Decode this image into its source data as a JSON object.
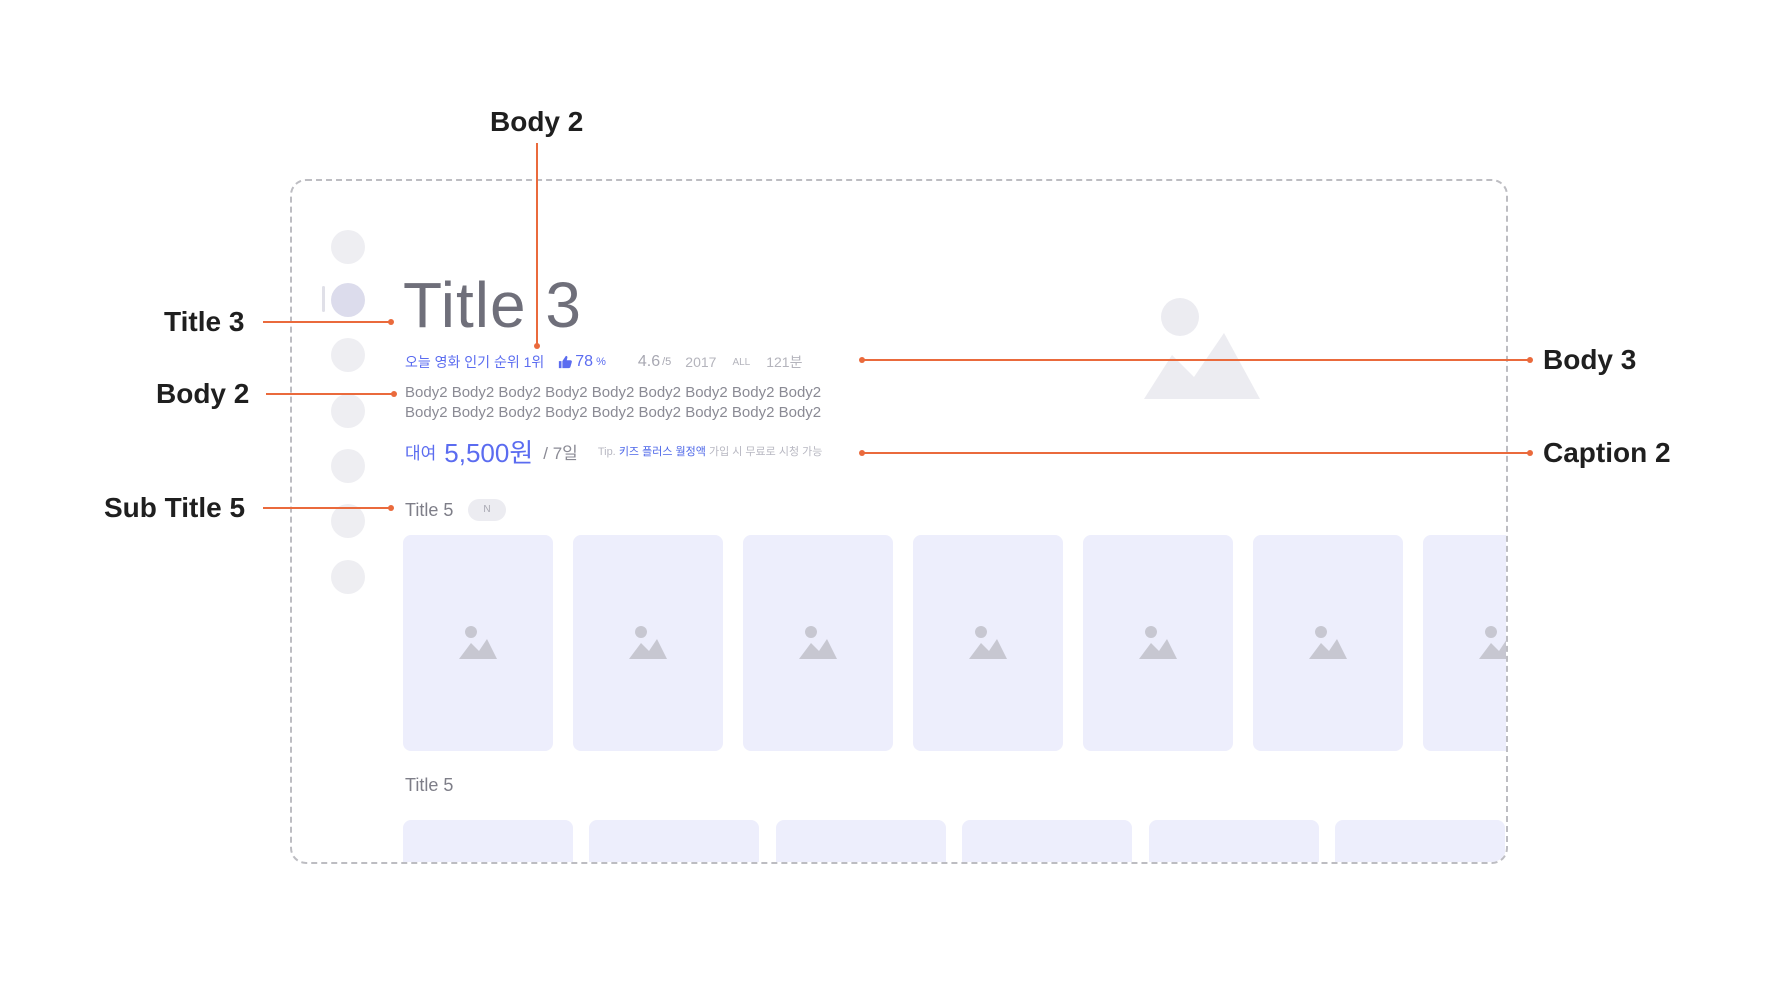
{
  "callouts": {
    "body2_top": "Body 2",
    "title3": "Title 3",
    "body2_left": "Body 2",
    "subtitle5": "Sub Title 5",
    "body3": "Body 3",
    "caption2": "Caption 2"
  },
  "hero": {
    "title": "Title 3",
    "rank_text": "오늘 영화 인기 순위 1위",
    "like_percent": "78",
    "like_unit": "%",
    "rating": "4.6",
    "rating_max": "/5",
    "year": "2017",
    "age_rating": "ALL",
    "runtime": "121분",
    "description_line1": "Body2 Body2 Body2 Body2 Body2 Body2 Body2 Body2 Body2",
    "description_line2": "Body2 Body2 Body2 Body2 Body2 Body2 Body2  Body2 Body2"
  },
  "price": {
    "label": "대여",
    "value": "5,500원",
    "period": "/ 7일",
    "tip_prefix": "Tip.",
    "tip_link": "키즈 플러스 월정액",
    "tip_suffix": "가입 시 무료로 시청 가능"
  },
  "sections": [
    {
      "title": "Title 5",
      "badge": "N"
    },
    {
      "title": "Title 5"
    }
  ],
  "colors": {
    "accent": "#5b6cf0",
    "callout_line": "#ea6a3c",
    "card_bg": "#edeefc",
    "placeholder_icon": "#c7c7d1"
  },
  "icons": [
    "thumbs-up-icon",
    "image-placeholder-icon"
  ]
}
